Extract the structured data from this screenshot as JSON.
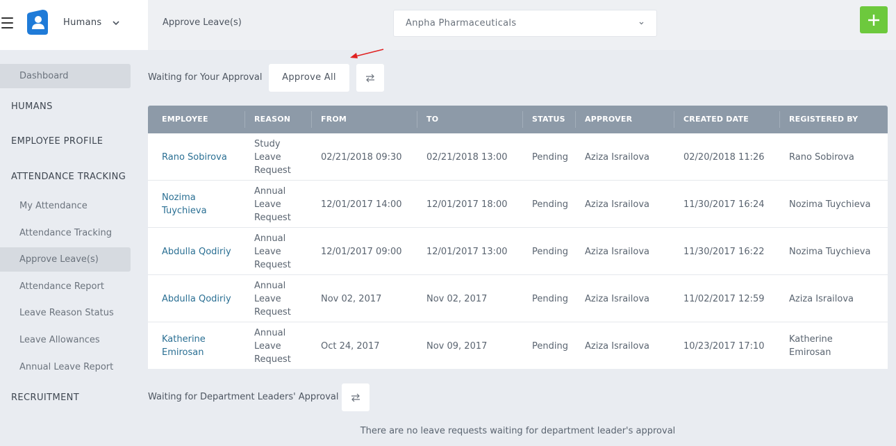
{
  "app": {
    "name": "Humans"
  },
  "header": {
    "page_title": "Approve Leave(s)",
    "company": "Anpha Pharmaceuticals"
  },
  "sidebar": {
    "dashboard": "Dashboard",
    "humans": "HUMANS",
    "employee_profile": "EMPLOYEE PROFILE",
    "attendance_tracking": "ATTENDANCE TRACKING",
    "sub_items": [
      "My Attendance",
      "Attendance Tracking",
      "Approve Leave(s)",
      "Attendance Report",
      "Leave Reason Status",
      "Leave Allowances",
      "Annual Leave Report"
    ],
    "recruitment": "RECRUITMENT"
  },
  "approval": {
    "section_label": "Waiting for Your Approval",
    "approve_all_label": "Approve All"
  },
  "table": {
    "columns": [
      "EMPLOYEE",
      "REASON",
      "FROM",
      "TO",
      "STATUS",
      "APPROVER",
      "CREATED DATE",
      "REGISTERED BY"
    ],
    "rows": [
      {
        "employee": [
          "Rano Sobirova"
        ],
        "reason": [
          "Study",
          "Leave",
          "Request"
        ],
        "from": "02/21/2018 09:30",
        "to": "02/21/2018 13:00",
        "status": "Pending",
        "approver": "Aziza Israilova",
        "created": "02/20/2018 11:26",
        "registered_by": [
          "Rano Sobirova"
        ]
      },
      {
        "employee": [
          "Nozima",
          "Tuychieva"
        ],
        "reason": [
          "Annual",
          "Leave",
          "Request"
        ],
        "from": "12/01/2017 14:00",
        "to": "12/01/2017 18:00",
        "status": "Pending",
        "approver": "Aziza Israilova",
        "created": "11/30/2017 16:24",
        "registered_by": [
          "Nozima Tuychieva"
        ]
      },
      {
        "employee": [
          "Abdulla Qodiriy"
        ],
        "reason": [
          "Annual",
          "Leave",
          "Request"
        ],
        "from": "12/01/2017 09:00",
        "to": "12/01/2017 13:00",
        "status": "Pending",
        "approver": "Aziza Israilova",
        "created": "11/30/2017 16:22",
        "registered_by": [
          "Nozima Tuychieva"
        ]
      },
      {
        "employee": [
          "Abdulla Qodiriy"
        ],
        "reason": [
          "Annual",
          "Leave",
          "Request"
        ],
        "from": "Nov 02, 2017",
        "to": "Nov 02, 2017",
        "status": "Pending",
        "approver": "Aziza Israilova",
        "created": "11/02/2017 12:59",
        "registered_by": [
          "Aziza Israilova"
        ]
      },
      {
        "employee": [
          "Katherine",
          "Emirosan"
        ],
        "reason": [
          "Annual",
          "Leave",
          "Request"
        ],
        "from": "Oct 24, 2017",
        "to": "Nov 09, 2017",
        "status": "Pending",
        "approver": "Aziza Israilova",
        "created": "10/23/2017 17:10",
        "registered_by": [
          "Katherine",
          "Emirosan"
        ]
      }
    ]
  },
  "department": {
    "section_label": "Waiting for Department Leaders' Approval",
    "empty_message": "There are no leave requests waiting for department leader's approval"
  },
  "colors": {
    "accent": "#6dc93d",
    "link": "#2a6f93",
    "header": "#8d9aa8",
    "logo": "#1f7bd8"
  }
}
